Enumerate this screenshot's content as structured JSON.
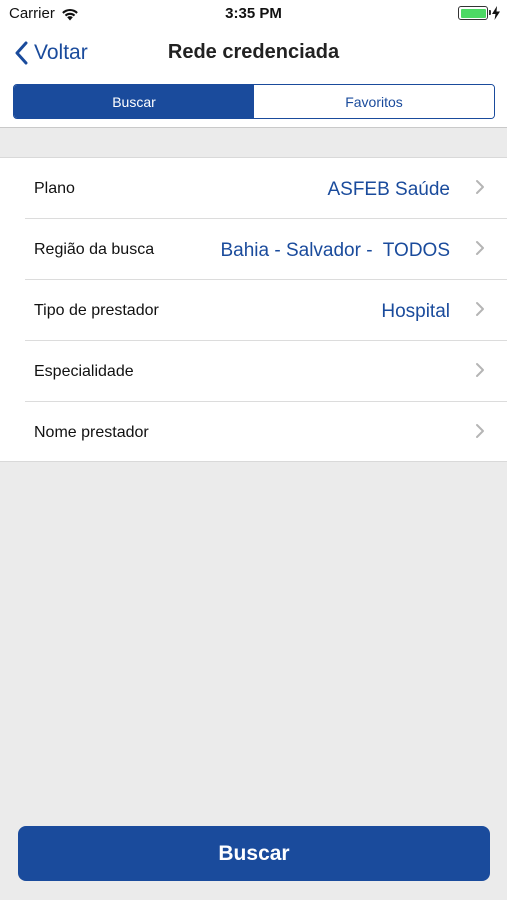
{
  "status_bar": {
    "carrier": "Carrier",
    "time": "3:35 PM",
    "battery_level": 1.0,
    "icons": [
      "wifi-icon",
      "battery-icon",
      "charging-bolt-icon"
    ]
  },
  "nav": {
    "back_label": "Voltar",
    "title": "Rede credenciada",
    "back_icon": "chevron-left-icon"
  },
  "tabs": [
    {
      "label": "Buscar",
      "selected": true
    },
    {
      "label": "Favoritos",
      "selected": false
    }
  ],
  "form": {
    "rows": [
      {
        "label": "Plano",
        "value": "ASFEB Saúde"
      },
      {
        "label": "Região da busca",
        "value": "Bahia - Salvador -  TODOS"
      },
      {
        "label": "Tipo de prestador",
        "value": "Hospital"
      },
      {
        "label": "Especialidade",
        "value": ""
      },
      {
        "label": "Nome prestador",
        "value": ""
      }
    ]
  },
  "actions": {
    "search_label": "Buscar"
  },
  "colors": {
    "accent": "#1a4b9c",
    "background": "#ebebeb",
    "surface": "#ffffff",
    "battery": "#4cd964"
  }
}
